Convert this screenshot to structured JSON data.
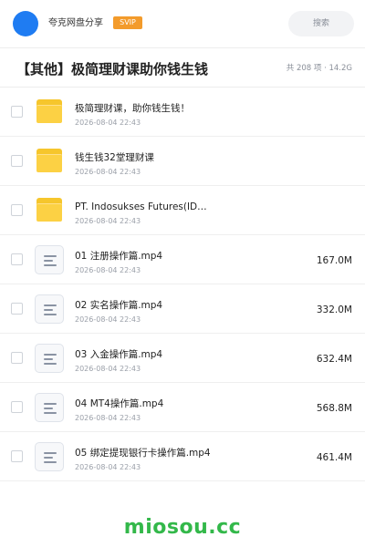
{
  "header": {
    "app_name": "夸克网盘分享",
    "badge": "SVIP",
    "search_label": "搜索"
  },
  "folder": {
    "title": "【其他】极简理财课助你钱生钱",
    "summary": "共 208 项 · 14.2G"
  },
  "items": [
    {
      "type": "folder",
      "name": "极简理财课，助你钱生钱！",
      "date": "2026-08-04 22:43",
      "size": ""
    },
    {
      "type": "folder",
      "name": "钱生钱32堂理财课",
      "date": "2026-08-04 22:43",
      "size": ""
    },
    {
      "type": "folder",
      "name": "PT. Indosukses Futures(ID…",
      "date": "2026-08-04 22:43",
      "size": ""
    },
    {
      "type": "file",
      "name": "01 注册操作篇.mp4",
      "date": "2026-08-04 22:43",
      "size": "167.0M"
    },
    {
      "type": "file",
      "name": "02 实名操作篇.mp4",
      "date": "2026-08-04 22:43",
      "size": "332.0M"
    },
    {
      "type": "file",
      "name": "03 入金操作篇.mp4",
      "date": "2026-08-04 22:43",
      "size": "632.4M"
    },
    {
      "type": "file",
      "name": "04 MT4操作篇.mp4",
      "date": "2026-08-04 22:43",
      "size": "568.8M"
    },
    {
      "type": "file",
      "name": "05 绑定提现银行卡操作篇.mp4",
      "date": "2026-08-04 22:43",
      "size": "461.4M"
    }
  ],
  "watermark": "miosou.cc",
  "colors": {
    "accent_blue": "#1f7cf2",
    "svip_orange": "#f39b2b",
    "folder_yellow": "#fcd144",
    "watermark_green": "#33b84a"
  }
}
